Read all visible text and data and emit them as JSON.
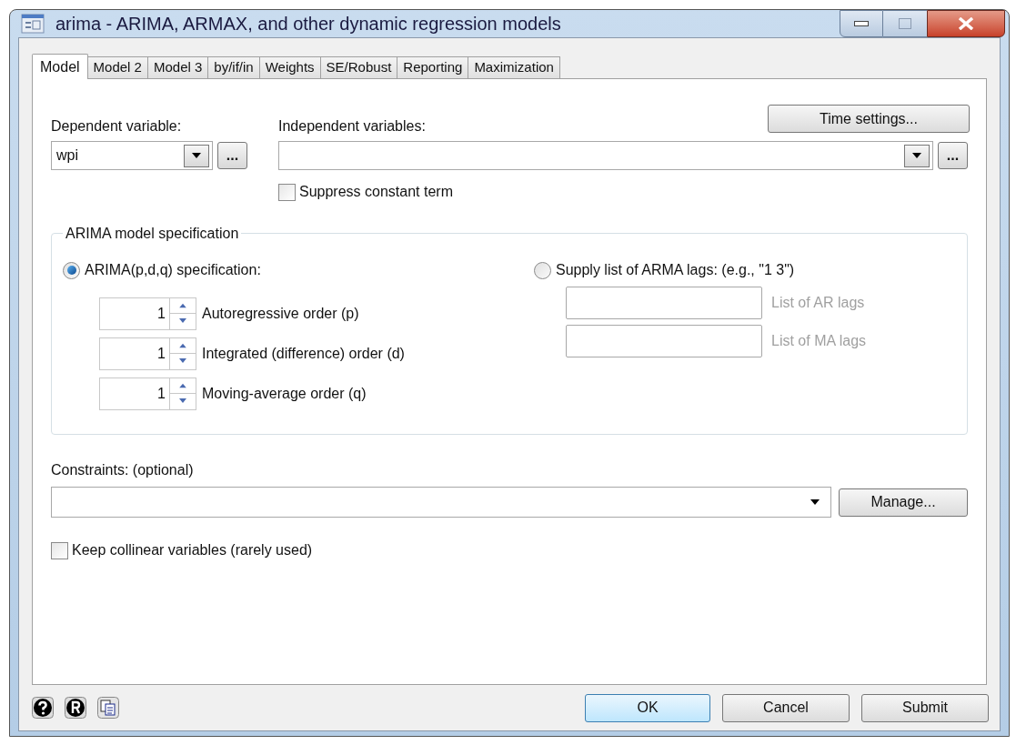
{
  "window": {
    "title": "arima - ARIMA, ARMAX, and other dynamic regression models"
  },
  "tabs": [
    {
      "label": "Model",
      "selected": true
    },
    {
      "label": "Model 2",
      "selected": false
    },
    {
      "label": "Model 3",
      "selected": false
    },
    {
      "label": "by/if/in",
      "selected": false
    },
    {
      "label": "Weights",
      "selected": false
    },
    {
      "label": "SE/Robust",
      "selected": false
    },
    {
      "label": "Reporting",
      "selected": false
    },
    {
      "label": "Maximization",
      "selected": false
    }
  ],
  "time_settings_button": "Time settings...",
  "dependent": {
    "label": "Dependent variable:",
    "value": "wpi",
    "browse": "..."
  },
  "independent": {
    "label": "Independent variables:",
    "browse": "..."
  },
  "suppress_constant": {
    "label": "Suppress constant term",
    "checked": false
  },
  "spec_group": {
    "title": "ARIMA model specification",
    "options": [
      {
        "label": "ARIMA(p,d,q) specification:",
        "selected": true
      },
      {
        "label": "Supply list of ARMA lags: (e.g., \"1 3\")",
        "selected": false
      }
    ],
    "orders": [
      {
        "value": "1",
        "label": "Autoregressive order (p)"
      },
      {
        "value": "1",
        "label": "Integrated (difference) order (d)"
      },
      {
        "value": "1",
        "label": "Moving-average order (q)"
      }
    ],
    "lags": [
      {
        "label": "List of AR lags",
        "disabled": true
      },
      {
        "label": "List of MA lags",
        "disabled": true
      }
    ]
  },
  "constraints": {
    "label": "Constraints: (optional)",
    "button": "Manage..."
  },
  "keep_collinear": {
    "label": "Keep collinear variables (rarely used)",
    "checked": false
  },
  "buttons": [
    "OK",
    "Cancel",
    "Submit"
  ]
}
